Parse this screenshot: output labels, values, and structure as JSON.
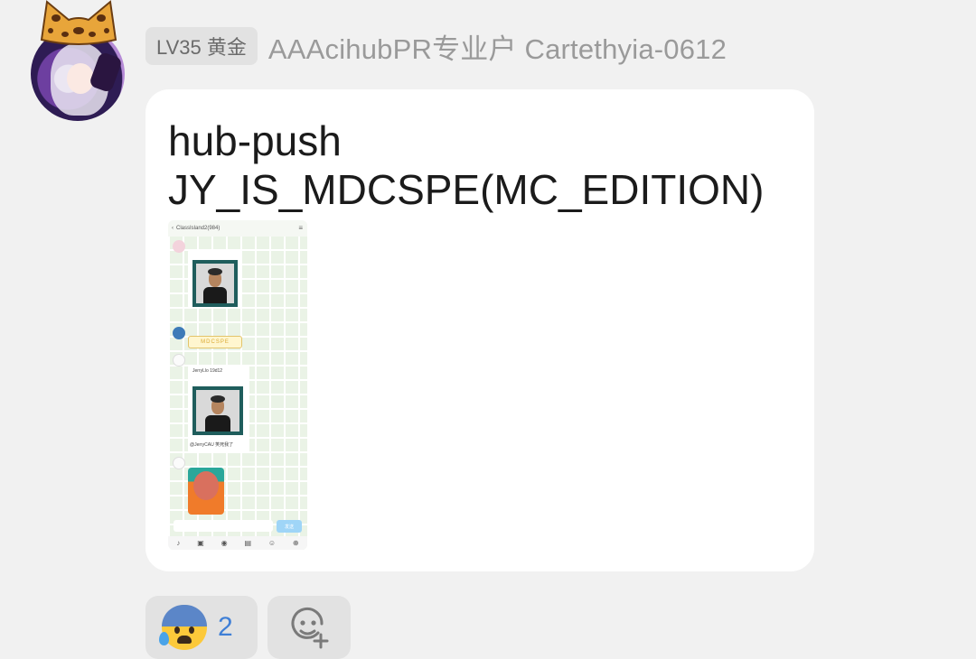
{
  "sender": {
    "avatar_icon": "anime-girl-avatar-icon",
    "frame_icon": "leopard-cat-ears-icon",
    "level_badge": "LV35 黄金",
    "name": "AAAcihubPR专业户 Cartethyia-0612"
  },
  "message": {
    "line1": "hub-push",
    "line2": "JY_IS_MDCSPE(MC_EDITION)",
    "embedded_screenshot": {
      "title": "ClassIsland2(984)",
      "sticker_text": "MDCSPE",
      "forward_caption": "JerryLlo 19d12",
      "reply_text": "@JerryCAU 笑死我了",
      "send_label": "发送"
    }
  },
  "reactions": [
    {
      "icon": "anxious-face-with-sweat-icon",
      "count": "2"
    },
    {
      "icon": "add-reaction-icon"
    }
  ],
  "colors": {
    "background": "#f1f1f1",
    "bubble": "#ffffff",
    "badge_bg": "#e2e2e2",
    "count_blue": "#3f7fd6"
  }
}
